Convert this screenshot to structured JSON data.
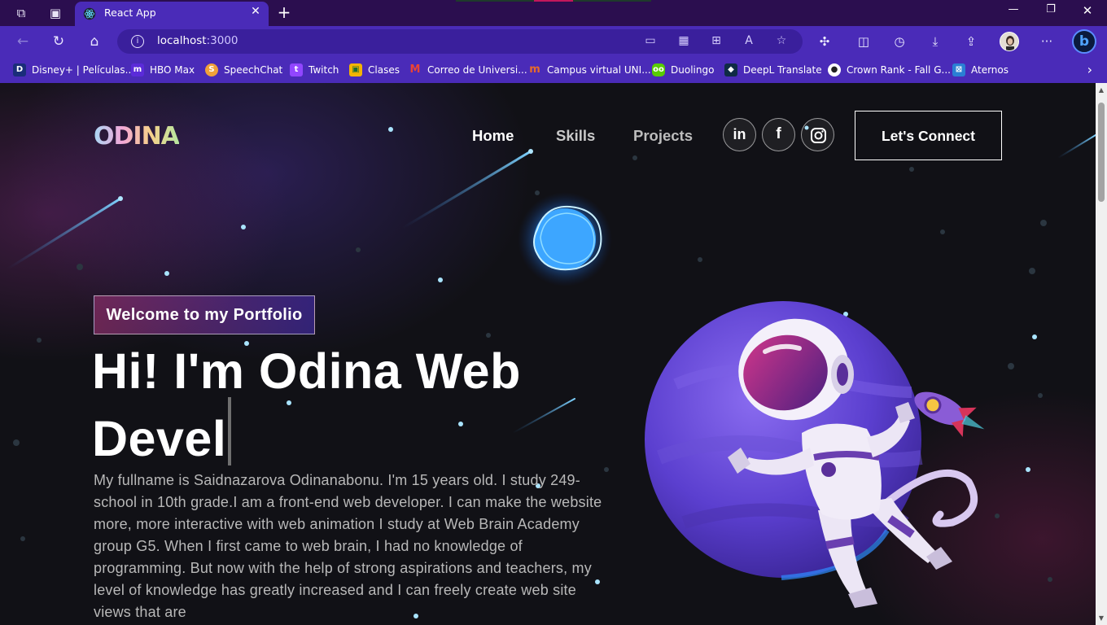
{
  "browser": {
    "tab": {
      "title": "React App"
    },
    "url": {
      "host": "localhost",
      "port": ":3000"
    },
    "favorites": [
      {
        "label": "Disney+ | Películas...",
        "icon": "disney-icon",
        "color": "#1a2d7a"
      },
      {
        "label": "HBO Max",
        "icon": "hbo-max-icon",
        "color": "#5b2bd9"
      },
      {
        "label": "SpeechChat",
        "icon": "speechchat-icon",
        "color": "#f0a13a"
      },
      {
        "label": "Twitch",
        "icon": "twitch-icon",
        "color": "#9146ff"
      },
      {
        "label": "Clases",
        "icon": "classroom-icon",
        "color": "#f4b400"
      },
      {
        "label": "Correo de Universi...",
        "icon": "gmail-icon",
        "color": "#ffffff"
      },
      {
        "label": "Campus virtual UNI...",
        "icon": "campus-icon",
        "color": "#e86a2a"
      },
      {
        "label": "Duolingo",
        "icon": "duolingo-icon",
        "color": "#58cc02"
      },
      {
        "label": "DeepL Translate",
        "icon": "deepl-icon",
        "color": "#0f2b46"
      },
      {
        "label": "Crown Rank - Fall G...",
        "icon": "crown-rank-icon",
        "color": "#ffffff"
      },
      {
        "label": "Aternos",
        "icon": "aternos-icon",
        "color": "#2a7fd4"
      }
    ]
  },
  "site": {
    "logo": "ODINA",
    "nav": [
      {
        "label": "Home",
        "color": "#ffffff"
      },
      {
        "label": "Skills",
        "color": "#c9c9c9"
      },
      {
        "label": "Projects",
        "color": "#bdbdbd"
      }
    ],
    "social": [
      {
        "name": "linkedin",
        "glyph": "in"
      },
      {
        "name": "facebook",
        "glyph": "f"
      },
      {
        "name": "instagram",
        "glyph": "◎"
      }
    ],
    "connect_label": "Let's Connect",
    "badge": "Welcome to my Portfolio",
    "headline_line1": "Hi! I'm Odina Web",
    "headline_line2": "Devel",
    "bio": "My fullname is Saidnazarova Odinanabonu. I'm 15 years old. I study 249-school in 10th grade.I am a front-end web developer. I can make the website more, more interactive with web animation I study at Web Brain Academy group G5. When I first came to web brain, I had no knowledge of programming. But now with the help of strong aspirations and teachers, my level of knowledge has greatly increased and I can freely create web site views that are",
    "accent_colors": {
      "purple": "#4a2bb8",
      "pink": "#aa367c",
      "planet": "#6a4fd6"
    }
  }
}
